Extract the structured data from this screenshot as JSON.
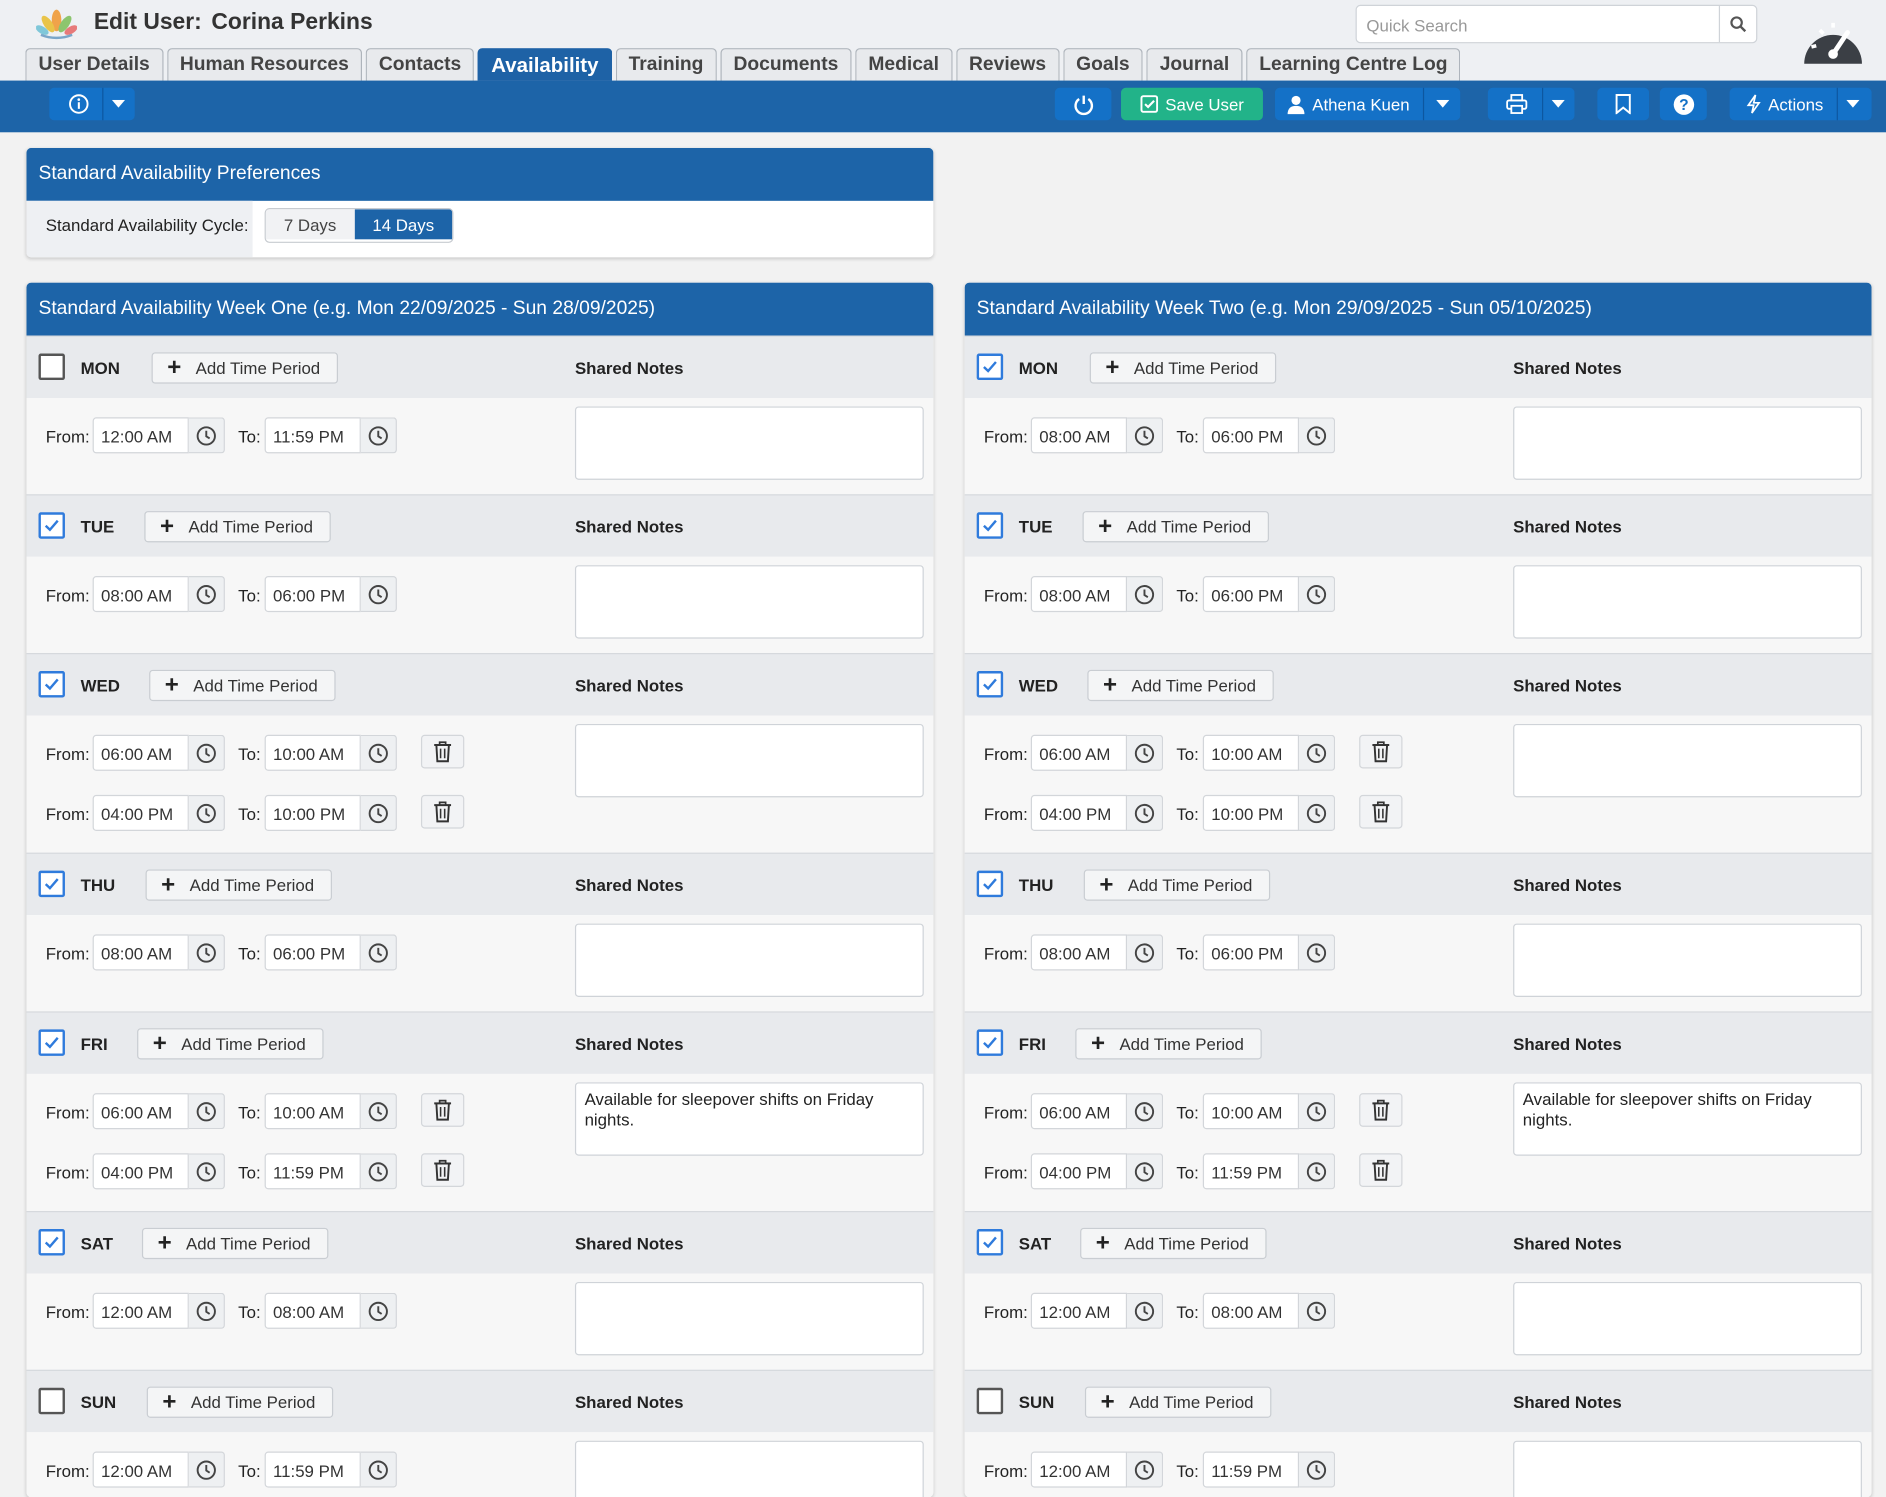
{
  "header": {
    "title_prefix": "Edit User:",
    "user_name": "Corina Perkins",
    "search_placeholder": "Quick Search"
  },
  "tabs": [
    {
      "label": "User Details",
      "active": false
    },
    {
      "label": "Human Resources",
      "active": false
    },
    {
      "label": "Contacts",
      "active": false
    },
    {
      "label": "Availability",
      "active": true
    },
    {
      "label": "Training",
      "active": false
    },
    {
      "label": "Documents",
      "active": false
    },
    {
      "label": "Medical",
      "active": false
    },
    {
      "label": "Reviews",
      "active": false
    },
    {
      "label": "Goals",
      "active": false
    },
    {
      "label": "Journal",
      "active": false
    },
    {
      "label": "Learning Centre Log",
      "active": false
    }
  ],
  "toolbar": {
    "save_label": "Save User",
    "user_label": "Athena Kuen",
    "actions_label": "Actions"
  },
  "prefs": {
    "title": "Standard Availability Preferences",
    "cycle_label": "Standard Availability Cycle:",
    "options": [
      "7 Days",
      "14 Days"
    ],
    "selected": "14 Days"
  },
  "ui": {
    "add_label": "Add Time Period",
    "notes_label": "Shared Notes",
    "from_label": "From:",
    "to_label": "To:"
  },
  "weeks": [
    {
      "title": "Standard Availability Week One (e.g. Mon 22/09/2025 - Sun 28/09/2025)",
      "days": [
        {
          "name": "MON",
          "checked": false,
          "notes": "",
          "periods": [
            {
              "from": "12:00 AM",
              "to": "11:59 PM"
            }
          ]
        },
        {
          "name": "TUE",
          "checked": true,
          "notes": "",
          "periods": [
            {
              "from": "08:00 AM",
              "to": "06:00 PM"
            }
          ]
        },
        {
          "name": "WED",
          "checked": true,
          "notes": "",
          "periods": [
            {
              "from": "06:00 AM",
              "to": "10:00 AM"
            },
            {
              "from": "04:00 PM",
              "to": "10:00 PM"
            }
          ]
        },
        {
          "name": "THU",
          "checked": true,
          "notes": "",
          "periods": [
            {
              "from": "08:00 AM",
              "to": "06:00 PM"
            }
          ]
        },
        {
          "name": "FRI",
          "checked": true,
          "notes": "Available for sleepover shifts on Friday nights.",
          "periods": [
            {
              "from": "06:00 AM",
              "to": "10:00 AM"
            },
            {
              "from": "04:00 PM",
              "to": "11:59 PM"
            }
          ]
        },
        {
          "name": "SAT",
          "checked": true,
          "notes": "",
          "periods": [
            {
              "from": "12:00 AM",
              "to": "08:00 AM"
            }
          ]
        },
        {
          "name": "SUN",
          "checked": false,
          "notes": "",
          "periods": [
            {
              "from": "12:00 AM",
              "to": "11:59 PM"
            }
          ]
        }
      ]
    },
    {
      "title": "Standard Availability Week Two (e.g. Mon 29/09/2025 - Sun 05/10/2025)",
      "days": [
        {
          "name": "MON",
          "checked": true,
          "notes": "",
          "periods": [
            {
              "from": "08:00 AM",
              "to": "06:00 PM"
            }
          ]
        },
        {
          "name": "TUE",
          "checked": true,
          "notes": "",
          "periods": [
            {
              "from": "08:00 AM",
              "to": "06:00 PM"
            }
          ]
        },
        {
          "name": "WED",
          "checked": true,
          "notes": "",
          "periods": [
            {
              "from": "06:00 AM",
              "to": "10:00 AM"
            },
            {
              "from": "04:00 PM",
              "to": "10:00 PM"
            }
          ]
        },
        {
          "name": "THU",
          "checked": true,
          "notes": "",
          "periods": [
            {
              "from": "08:00 AM",
              "to": "06:00 PM"
            }
          ]
        },
        {
          "name": "FRI",
          "checked": true,
          "notes": "Available for sleepover shifts on Friday nights.",
          "periods": [
            {
              "from": "06:00 AM",
              "to": "10:00 AM"
            },
            {
              "from": "04:00 PM",
              "to": "11:59 PM"
            }
          ]
        },
        {
          "name": "SAT",
          "checked": true,
          "notes": "",
          "periods": [
            {
              "from": "12:00 AM",
              "to": "08:00 AM"
            }
          ]
        },
        {
          "name": "SUN",
          "checked": false,
          "notes": "",
          "periods": [
            {
              "from": "12:00 AM",
              "to": "11:59 PM"
            }
          ]
        }
      ]
    }
  ],
  "colors": {
    "brand_blue": "#1d64a8",
    "save_green": "#22b389",
    "check_blue": "#2f7bdc"
  }
}
